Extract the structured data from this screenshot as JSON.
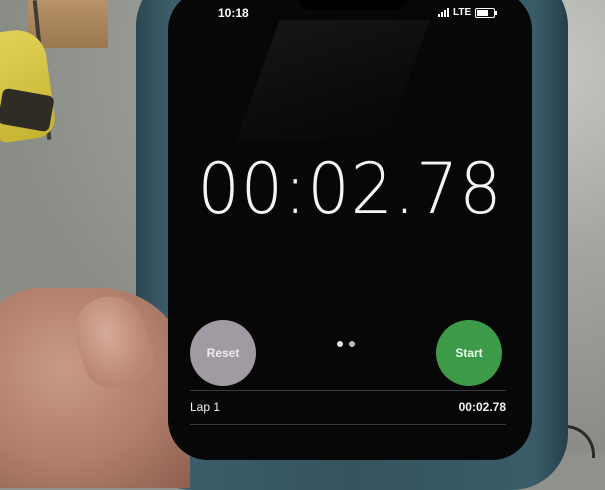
{
  "status_bar": {
    "time": "10:18",
    "network": "LTE",
    "signal_bars": 4,
    "battery_level": 0.8
  },
  "stopwatch": {
    "elapsed": "00:02.78",
    "reset_label": "Reset",
    "start_label": "Start",
    "page_count": 2
  },
  "laps": [
    {
      "label": "Lap 1",
      "time": "00:02.78"
    }
  ],
  "colors": {
    "screen": "#070707",
    "start_button": "#3d9a48",
    "reset_button": "#a09aa2",
    "case": "#35535f"
  },
  "icons": [
    "signal-bars-icon",
    "battery-icon"
  ]
}
